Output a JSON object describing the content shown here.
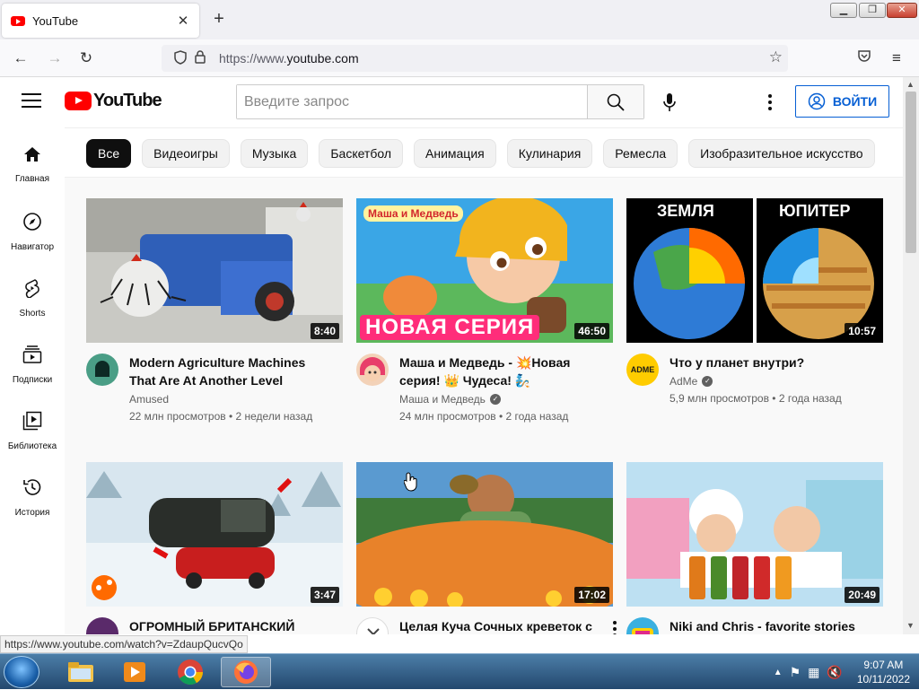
{
  "browser": {
    "tab_title": "YouTube",
    "url_prefix": "https://www.",
    "url_domain": "youtube.com",
    "status_url": "https://www.youtube.com/watch?v=ZdaupQucvQo"
  },
  "youtube": {
    "logo_text": "YouTube",
    "search_placeholder": "Введите запрос",
    "sign_in_label": "ВОЙТИ",
    "accent_color": "#ff0000",
    "link_color": "#065fd4"
  },
  "sidebar": {
    "items": [
      {
        "label": "Главная",
        "icon": "home-icon"
      },
      {
        "label": "Навигатор",
        "icon": "compass-icon"
      },
      {
        "label": "Shorts",
        "icon": "shorts-icon"
      },
      {
        "label": "Подписки",
        "icon": "subscriptions-icon"
      },
      {
        "label": "Библиотека",
        "icon": "library-icon"
      },
      {
        "label": "История",
        "icon": "history-icon"
      }
    ]
  },
  "chips": [
    "Все",
    "Видеоигры",
    "Музыка",
    "Баскетбол",
    "Анимация",
    "Кулинария",
    "Ремесла",
    "Изобразительное искусство"
  ],
  "videos": [
    {
      "title": "Modern Agriculture Machines That Are At Another Level",
      "channel": "Amused",
      "views": "22 млн просмотров",
      "age": "2 недели назад",
      "duration": "8:40",
      "verified": false
    },
    {
      "title": "Маша и Медведь - 💥Новая серия! 👑 Чудеса! 🧞",
      "channel": "Маша и Медведь",
      "views": "24 млн просмотров",
      "age": "2 года назад",
      "duration": "46:50",
      "verified": true,
      "thumb_text": "НОВАЯ СЕРИЯ",
      "thumb_logo": "Маша и Медведь"
    },
    {
      "title": "Что у планет внутри?",
      "channel": "AdMe",
      "views": "5,9 млн просмотров",
      "age": "2 года назад",
      "duration": "10:57",
      "verified": true,
      "thumb_left": "ЗЕМЛЯ",
      "thumb_right": "ЮПИТЕР",
      "avatar_text": "ADME"
    },
    {
      "title": "ОГРОМНЫЙ БРИТАНСКИЙ МАШИН...",
      "duration": "3:47"
    },
    {
      "title": "Целая Куча Сочных креветок с лимоном! Идеальная закуска ...",
      "duration": "17:02"
    },
    {
      "title": "Niki and Chris - favorite stories with little brother",
      "duration": "20:49"
    }
  ],
  "taskbar": {
    "time": "9:07 AM",
    "date": "10/11/2022"
  }
}
